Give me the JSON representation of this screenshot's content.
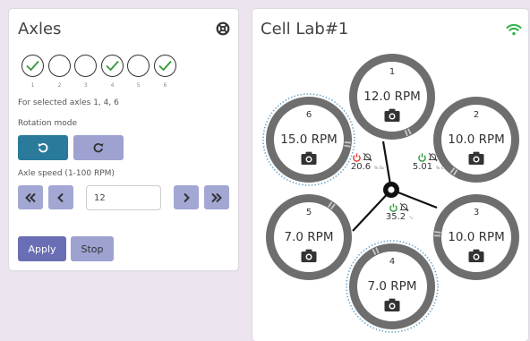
{
  "left_panel": {
    "title": "Axles",
    "axles": [
      {
        "label": "1",
        "selected": true
      },
      {
        "label": "2",
        "selected": false
      },
      {
        "label": "3",
        "selected": false
      },
      {
        "label": "4",
        "selected": true
      },
      {
        "label": "5",
        "selected": false
      },
      {
        "label": "6",
        "selected": true
      }
    ],
    "selected_text": "For selected axles 1, 4, 6",
    "rotation_mode_label": "Rotation mode",
    "axle_speed_label": "Axle speed (1-100 RPM)",
    "speed_value": "12",
    "apply_label": "Apply",
    "stop_label": "Stop"
  },
  "right_panel": {
    "title": "Cell Lab#1",
    "wells": [
      {
        "index": "1",
        "rpm": "12.0 RPM",
        "active": false
      },
      {
        "index": "2",
        "rpm": "10.0 RPM",
        "active": false
      },
      {
        "index": "3",
        "rpm": "10.0 RPM",
        "active": false
      },
      {
        "index": "4",
        "rpm": "7.0 RPM",
        "active": true
      },
      {
        "index": "5",
        "rpm": "7.0 RPM",
        "active": false
      },
      {
        "index": "6",
        "rpm": "15.0 RPM",
        "active": true
      }
    ],
    "sensors": [
      {
        "value": "20.6",
        "unit": "% O₂",
        "power": "off"
      },
      {
        "value": "5.01",
        "unit": "% CO₂",
        "power": "on"
      },
      {
        "value": "35.2",
        "unit": "°c",
        "power": "on"
      }
    ]
  },
  "colors": {
    "accent_teal": "#2a7a9c",
    "lavender": "#9da2d1",
    "check_green": "#3a9a3a",
    "power_on": "#2e9a3a",
    "power_off": "#e53935",
    "wifi": "#2eb14a",
    "ring": "#6e6e6e"
  }
}
